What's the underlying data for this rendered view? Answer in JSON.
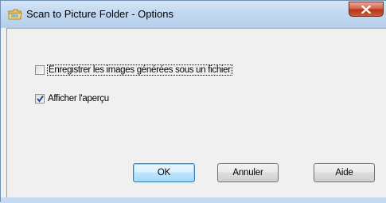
{
  "window": {
    "title": "Scan to Picture Folder - Options",
    "icon": "folder-scan-icon",
    "close_icon": "close-icon",
    "accent_color": "#c2d8f0",
    "close_color": "#c8462a"
  },
  "options": [
    {
      "label": "Enregistrer les images générées sous un fichier",
      "checked": false
    },
    {
      "label": "Afficher l'aperçu",
      "checked": true
    }
  ],
  "buttons": {
    "ok": "OK",
    "cancel": "Annuler",
    "help": "Aide"
  }
}
